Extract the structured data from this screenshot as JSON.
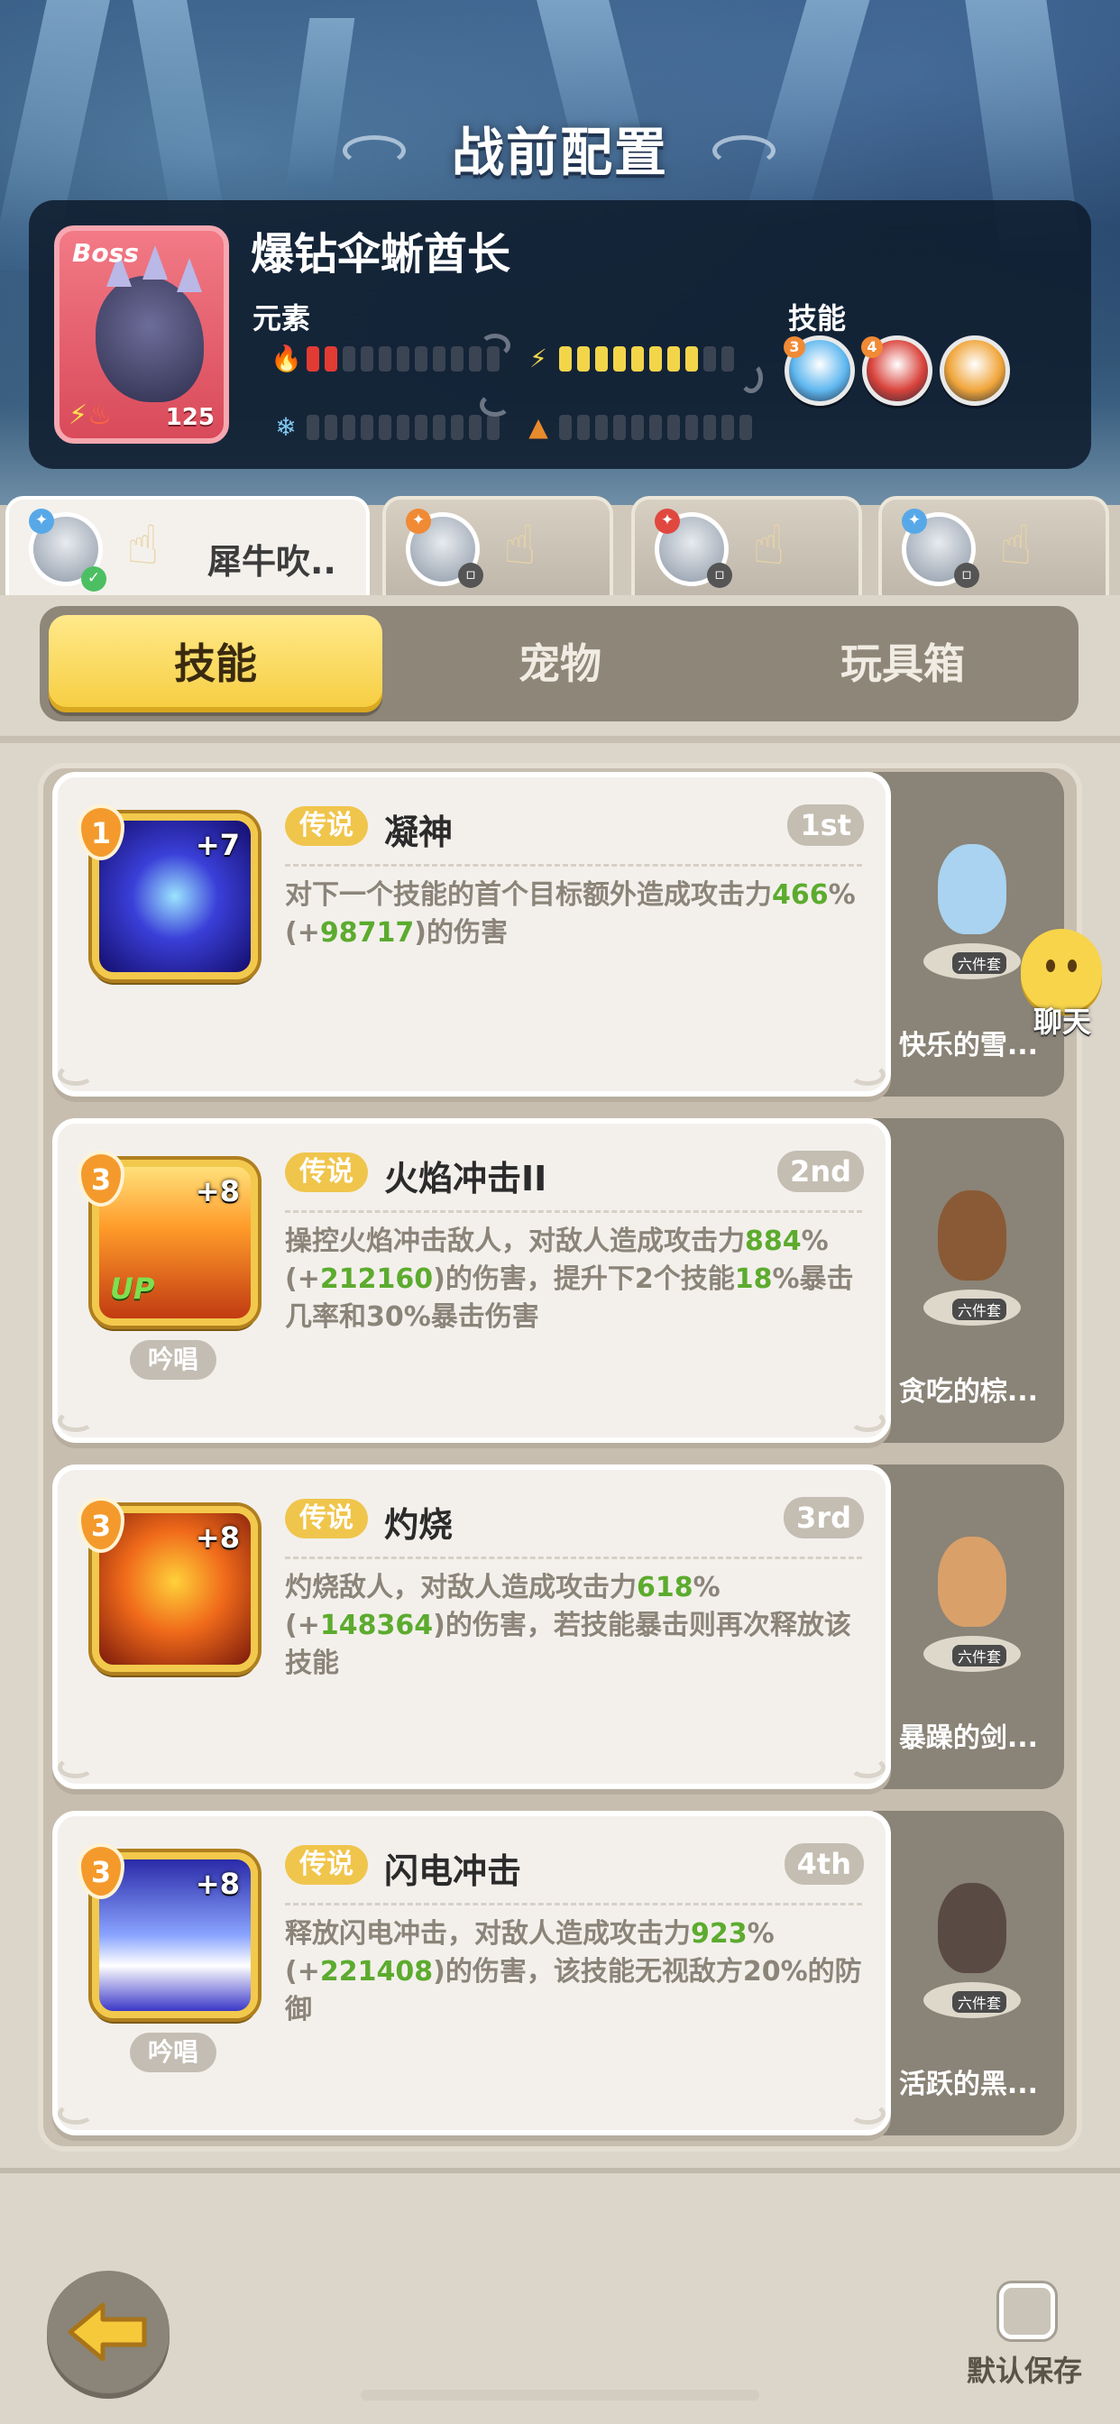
{
  "header": {
    "title": "战前配置"
  },
  "boss": {
    "tag": "Boss",
    "level": "125",
    "name": "爆钻伞蜥酋长",
    "element_label": "元素",
    "skills_label": "技能",
    "elements": [
      {
        "icon": "fire-icon",
        "color": "#e23b34",
        "filled": 2,
        "total": 11
      },
      {
        "icon": "lightning-icon",
        "color": "#f3d54a",
        "filled": 8,
        "total": 10
      },
      {
        "icon": "ice-icon",
        "color": "#7fc7ef",
        "filled": 0,
        "total": 11
      },
      {
        "icon": "earth-icon",
        "color": "#e98b2d",
        "filled": 0,
        "total": 11
      }
    ],
    "skill_orbs": [
      {
        "icon": "ice-shard-skill-icon",
        "badge": "3",
        "color": "#5fb7ef"
      },
      {
        "icon": "dark-bird-skill-icon",
        "badge": "4",
        "color": "#d9433b"
      },
      {
        "icon": "crown-skill-icon",
        "badge": "",
        "color": "#f0a53a"
      }
    ]
  },
  "players": [
    {
      "name": "犀牛吹..",
      "active": true,
      "badge_color": "#4cbf63"
    },
    {
      "name": "",
      "active": false,
      "badge_color": "#f08a35"
    },
    {
      "name": "",
      "active": false,
      "badge_color": "#e0483f"
    },
    {
      "name": "",
      "active": false,
      "badge_color": "#58a8e8"
    }
  ],
  "tabs": {
    "skills": "技能",
    "pets": "宠物",
    "toybox": "玩具箱"
  },
  "cards": [
    {
      "level": "1",
      "plus": "+7",
      "up": "",
      "chant": "",
      "rarity": "传说",
      "name": "凝神",
      "order": "1st",
      "desc_parts": [
        {
          "t": "对下一个技能的首个目标额外造成攻击力",
          "g": false
        },
        {
          "t": "466",
          "g": true
        },
        {
          "t": "%(+",
          "g": false
        },
        {
          "t": "98717",
          "g": true
        },
        {
          "t": ")的伤害",
          "g": false
        }
      ],
      "pet_name": "快乐的雪...",
      "pet_tag": "六件套"
    },
    {
      "level": "3",
      "plus": "+8",
      "up": "UP",
      "chant": "吟唱",
      "rarity": "传说",
      "name": "火焰冲击II",
      "order": "2nd",
      "desc_parts": [
        {
          "t": "操控火焰冲击敌人，对敌人造成攻击力",
          "g": false
        },
        {
          "t": "884",
          "g": true
        },
        {
          "t": "%(+",
          "g": false
        },
        {
          "t": "212160",
          "g": true
        },
        {
          "t": ")的伤害，提升下2个技能",
          "g": false
        },
        {
          "t": "18",
          "g": true
        },
        {
          "t": "%暴击几率和30%暴击伤害",
          "g": false
        }
      ],
      "pet_name": "贪吃的棕...",
      "pet_tag": "六件套"
    },
    {
      "level": "3",
      "plus": "+8",
      "up": "",
      "chant": "",
      "rarity": "传说",
      "name": "灼烧",
      "order": "3rd",
      "desc_parts": [
        {
          "t": "灼烧敌人，对敌人造成攻击力",
          "g": false
        },
        {
          "t": "618",
          "g": true
        },
        {
          "t": "%(+",
          "g": false
        },
        {
          "t": "148364",
          "g": true
        },
        {
          "t": ")的伤害，若技能暴击则再次释放该技能",
          "g": false
        }
      ],
      "pet_name": "暴躁的剑...",
      "pet_tag": "六件套"
    },
    {
      "level": "3",
      "plus": "+8",
      "up": "",
      "chant": "吟唱",
      "rarity": "传说",
      "name": "闪电冲击",
      "order": "4th",
      "desc_parts": [
        {
          "t": "释放闪电冲击，对敌人造成攻击力",
          "g": false
        },
        {
          "t": "923",
          "g": true
        },
        {
          "t": "%(+",
          "g": false
        },
        {
          "t": "221408",
          "g": true
        },
        {
          "t": ")的伤害，该技能无视敌方20%的防御",
          "g": false
        }
      ],
      "pet_name": "活跃的黑...",
      "pet_tag": "六件套"
    }
  ],
  "chat": {
    "label": "聊天"
  },
  "footer": {
    "save_label": "默认保存"
  }
}
